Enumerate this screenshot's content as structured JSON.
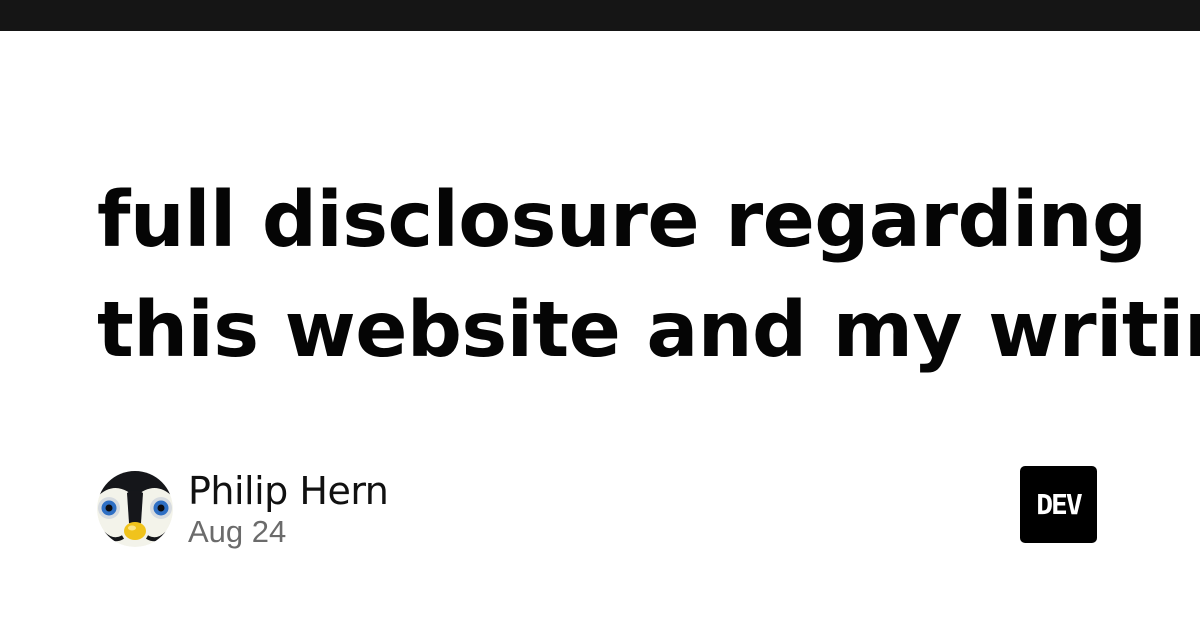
{
  "header": {
    "bar_color": "#151515"
  },
  "article": {
    "title_line1": "full disclosure regarding",
    "title_line2": "this website and my writing"
  },
  "author": {
    "name": "Philip Hern",
    "date": "Aug 24",
    "avatar_icon": "penguin-face-avatar"
  },
  "brand": {
    "logo_text": "DEV",
    "logo_icon": "dev-logo-icon"
  }
}
